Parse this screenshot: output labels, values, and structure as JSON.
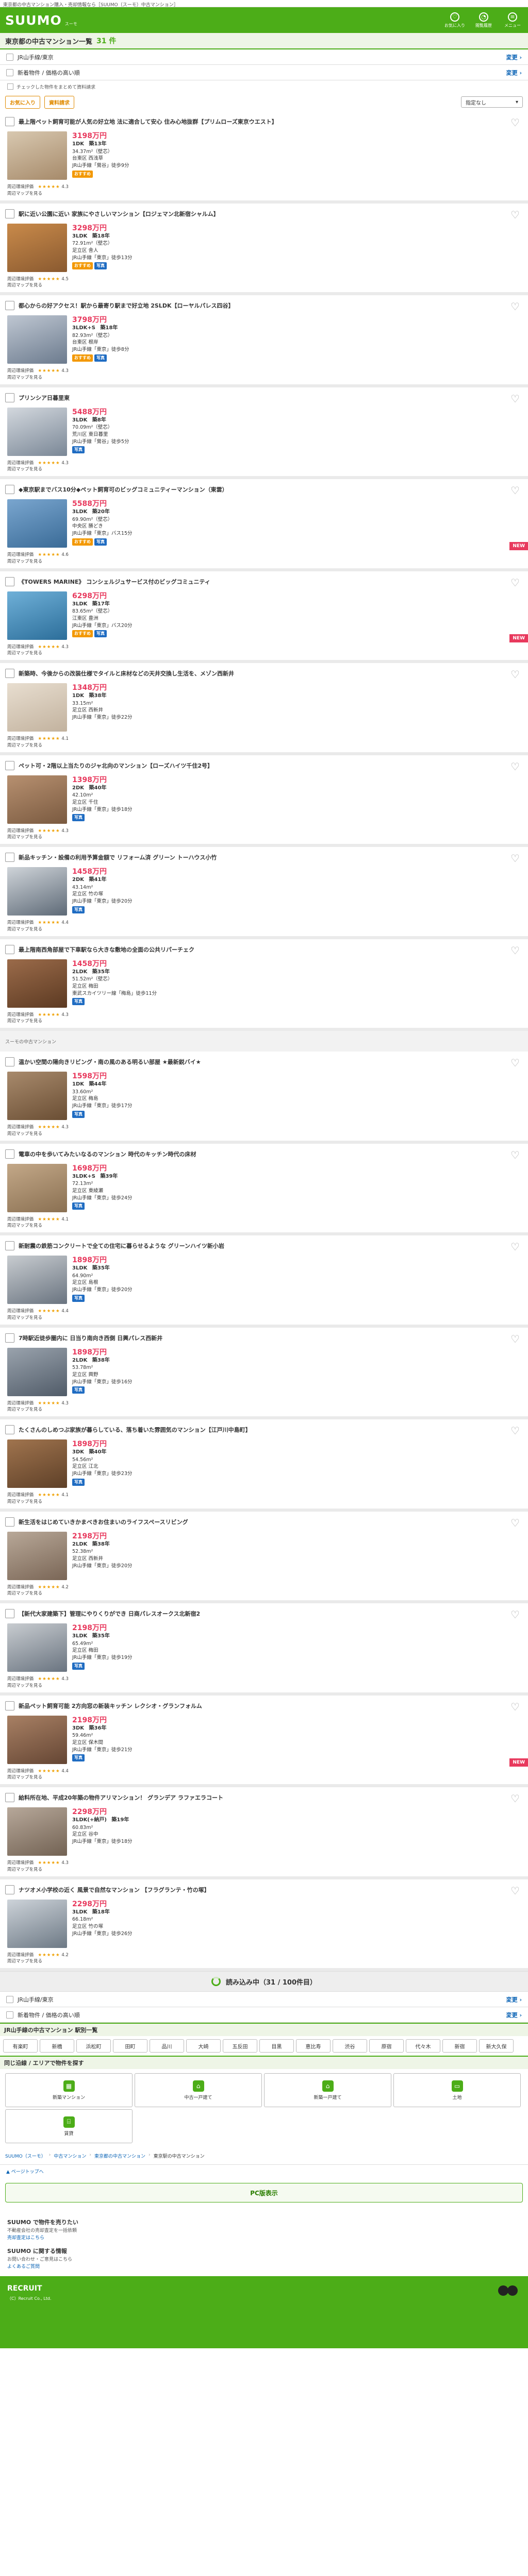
{
  "top_note": "東京都の中古マンション購入・売却情報なら［SUUMO（スーモ）中古マンション］",
  "header": {
    "logo": "SUUMO",
    "logo_sub": "スーモ",
    "icons": [
      {
        "label": "お気に入り",
        "glyph": "♡",
        "icon": "heart-icon"
      },
      {
        "label": "閲覧履歴",
        "glyph": "◔",
        "icon": "history-icon"
      },
      {
        "label": "メニュー",
        "glyph": "≡",
        "icon": "menu-icon"
      }
    ]
  },
  "title": {
    "text": "東京都の中古マンション一覧",
    "count": "31 件"
  },
  "conditions": [
    {
      "text": "JR山手線/東京",
      "link": "変更"
    },
    {
      "text": "新着物件 / 価格の高い順",
      "link": "変更"
    }
  ],
  "check_note": "チェックした物件をまとめて資料請求",
  "sort": {
    "btn1": "お気に入り",
    "btn2": "資料請求",
    "select": "指定なし"
  },
  "listings": [
    {
      "title": "最上階ペット飼育可能が人気の好立地 法に適合して安心 住み心地抜群【プリムローズ東京ウエスト】",
      "price": "3198万円",
      "layout": "1DK",
      "floor": "築13年",
      "area": "34.37m²（壁芯）",
      "addr": "台東区 西浅草",
      "access": "JR山手線「鶯谷」徒歩9分",
      "tags": [
        "o"
      ],
      "stars": "★★★★★",
      "score": "4.3",
      "new": false,
      "c1": "#d8c8b0",
      "c2": "#a68a6a"
    },
    {
      "title": "駅に近い公園に近い 家族にやさしいマンション【ロジェマン北新宿シャルム】",
      "price": "3298万円",
      "layout": "3LDK",
      "floor": "築18年",
      "area": "72.91m²（壁芯）",
      "addr": "足立区 舎人",
      "access": "JR山手線「東京」徒歩13分",
      "tags": [
        "o",
        "b"
      ],
      "stars": "★★★★★",
      "score": "4.5",
      "new": false,
      "c1": "#c98a4a",
      "c2": "#8a5a30"
    },
    {
      "title": "都心からの好アクセス！駅から最寄り駅まで好立地 2SLDK【ローヤルパレス四谷】",
      "price": "3798万円",
      "layout": "3LDK+S",
      "floor": "築18年",
      "area": "82.93m²（壁芯）",
      "addr": "台東区 根岸",
      "access": "JR山手線「東京」徒歩8分",
      "tags": [
        "o",
        "b"
      ],
      "stars": "★★★★★",
      "score": "4.3",
      "new": false,
      "c1": "#bfc7d2",
      "c2": "#6c7b8e"
    },
    {
      "title": "プリンシア日暮里東",
      "price": "5488万円",
      "layout": "3LDK",
      "floor": "築8年",
      "area": "70.09m²（壁芯）",
      "addr": "荒川区 東日暮里",
      "access": "JR山手線「鶯谷」徒歩5分",
      "tags": [
        "b"
      ],
      "stars": "★★★★★",
      "score": "4.3",
      "new": false,
      "c1": "#d3d8de",
      "c2": "#7a8796"
    },
    {
      "title": "◆東京駅までバス10分◆ペット飼育可のビッグコミュニティーマンション（東雲）",
      "price": "5588万円",
      "layout": "3LDK",
      "floor": "築20年",
      "area": "69.90m²（壁芯）",
      "addr": "中央区 勝どき",
      "access": "JR山手線「東京」バス15分",
      "tags": [
        "o",
        "b"
      ],
      "stars": "★★★★★",
      "score": "4.6",
      "new": true,
      "c1": "#7aa6cf",
      "c2": "#3a6b97"
    },
    {
      "title": "《TOWERS MARINE》 コンシェルジュサービス付のビッグコミュニティ",
      "price": "6298万円",
      "layout": "3LDK",
      "floor": "築17年",
      "area": "83.65m²（壁芯）",
      "addr": "江東区 豊洲",
      "access": "JR山手線「東京」バス20分",
      "tags": [
        "o",
        "b"
      ],
      "stars": "★★★★★",
      "score": "4.3",
      "new": true,
      "c1": "#6fb0d8",
      "c2": "#2c6e9a"
    },
    {
      "title": "新築時、今後からの改装仕様でタイルと床材などの天井交換し生活を、メゾン西新井",
      "price": "1348万円",
      "layout": "1DK",
      "floor": "築38年",
      "area": "33.15m²",
      "addr": "足立区 西新井",
      "access": "JR山手線「東京」徒歩22分",
      "tags": [],
      "stars": "★★★★★",
      "score": "4.1",
      "new": false,
      "c1": "#e8ded0",
      "c2": "#c2b29e"
    },
    {
      "title": "ペット可・2階以上当たりのジャ北向のマンション【ローズハイツ千住2号】",
      "price": "1398万円",
      "layout": "2DK",
      "floor": "築40年",
      "area": "42.10m²",
      "addr": "足立区 千住",
      "access": "JR山手線「東京」徒歩18分",
      "tags": [
        "b"
      ],
      "stars": "★★★★★",
      "score": "4.3",
      "new": false,
      "c1": "#b79070",
      "c2": "#7a5a40"
    },
    {
      "title": "新品キッチン・設備の利用予算金額で リフォーム済 グリーン トーハウス小竹",
      "price": "1458万円",
      "layout": "2DK",
      "floor": "築41年",
      "area": "43.14m²",
      "addr": "足立区 竹の塚",
      "access": "JR山手線「東京」徒歩20分",
      "tags": [
        "b"
      ],
      "stars": "★★★★★",
      "score": "4.4",
      "new": false,
      "c1": "#cfd4d9",
      "c2": "#5e6a77"
    },
    {
      "title": "最上階南西角部屋で下車駅なら大きな敷地の全面の公共リパーチェク",
      "price": "1458万円",
      "layout": "2LDK",
      "floor": "築35年",
      "area": "51.52m²（壁芯）",
      "addr": "足立区 梅田",
      "access": "東武スカイツリー線「梅島」徒歩11分",
      "tags": [
        "b"
      ],
      "stars": "★★★★★",
      "score": "4.3",
      "new": false,
      "c1": "#9b6b4a",
      "c2": "#5c3a22"
    }
  ],
  "separator": "スーモの中古マンション",
  "listings2": [
    {
      "title": "温かい空間の陽向きリビング・南の風のある明るい部屋 ★最新鋭バイ★",
      "price": "1598万円",
      "layout": "1DK",
      "floor": "築44年",
      "area": "33.60m²",
      "addr": "足立区 梅島",
      "access": "JR山手線「東京」徒歩17分",
      "tags": [
        "b"
      ],
      "stars": "★★★★★",
      "score": "4.3",
      "new": false,
      "c1": "#a88a6c",
      "c2": "#6a4e34"
    },
    {
      "title": "電車の中を歩いてみたいなるのマンション 時代のキッチン時代の床材",
      "price": "1698万円",
      "layout": "3LDK+S",
      "floor": "築39年",
      "area": "72.13m²",
      "addr": "足立区 東綾瀬",
      "access": "JR山手線「東京」徒歩24分",
      "tags": [
        "b"
      ],
      "stars": "★★★★★",
      "score": "4.1",
      "new": false,
      "c1": "#c3a888",
      "c2": "#8a7052"
    },
    {
      "title": "新耐震の鉄筋コンクリートで全ての住宅に暮らせるような グリーンハイツ新小岩",
      "price": "1898万円",
      "layout": "3LDK",
      "floor": "築35年",
      "area": "64.90m²",
      "addr": "足立区 島根",
      "access": "JR山手線「東京」徒歩20分",
      "tags": [
        "b"
      ],
      "stars": "★★★★★",
      "score": "4.4",
      "new": false,
      "c1": "#c8ccd0",
      "c2": "#6a7480"
    },
    {
      "title": "7時駅近徒歩圏内に 日当り南向き西側 日興パレス西新井",
      "price": "1898万円",
      "layout": "2LDK",
      "floor": "築38年",
      "area": "53.78m²",
      "addr": "足立区 興野",
      "access": "JR山手線「東京」徒歩16分",
      "tags": [
        "b"
      ],
      "stars": "★★★★★",
      "score": "4.3",
      "new": false,
      "c1": "#9aa3ad",
      "c2": "#505b68"
    },
    {
      "title": "たくさんのしめつぶ家族が暮らしている、落ち着いた雰囲気のマンション【江戸川中島町】",
      "price": "1898万円",
      "layout": "3DK",
      "floor": "築40年",
      "area": "54.56m²",
      "addr": "足立区 江北",
      "access": "JR山手線「東京」徒歩23分",
      "tags": [
        "b"
      ],
      "stars": "★★★★★",
      "score": "4.1",
      "new": false,
      "c1": "#a0744e",
      "c2": "#5e4028"
    },
    {
      "title": "新生活をはじめていきかまべきお住まいのライフスペースリビング",
      "price": "2198万円",
      "layout": "2LDK",
      "floor": "築38年",
      "area": "52.38m²",
      "addr": "足立区 西新井",
      "access": "JR山手線「東京」徒歩20分",
      "tags": [],
      "stars": "★★★★★",
      "score": "4.2",
      "new": false,
      "c1": "#b8a898",
      "c2": "#7a6656"
    },
    {
      "title": "【新代大家建築下】管理にやりくりができ 日商パレスオークス北新宿2",
      "price": "2198万円",
      "layout": "3LDK",
      "floor": "築35年",
      "area": "65.49m²",
      "addr": "足立区 梅田",
      "access": "JR山手線「東京」徒歩19分",
      "tags": [
        "b"
      ],
      "stars": "★★★★★",
      "score": "4.3",
      "new": false,
      "c1": "#c8ccd0",
      "c2": "#6a7480"
    },
    {
      "title": "新品ペット飼育可能 2方向窓の新装キッチン レクシオ・グランフォルム",
      "price": "2198万円",
      "layout": "3DK",
      "floor": "築36年",
      "area": "59.46m²",
      "addr": "足立区 保木間",
      "access": "JR山手線「東京」徒歩21分",
      "tags": [
        "b"
      ],
      "stars": "★★★★★",
      "score": "4.4",
      "new": true,
      "c1": "#a88064",
      "c2": "#654634"
    },
    {
      "title": "給料所在地、平成20年築の物件アリマンション！ グランデア ラファエラコート",
      "price": "2298万円",
      "layout": "3LDK(+納戸)",
      "floor": "築19年",
      "area": "60.83m²",
      "addr": "足立区 谷中",
      "access": "JR山手線「東京」徒歩18分",
      "tags": [],
      "stars": "★★★★★",
      "score": "4.3",
      "new": false,
      "c1": "#b7a89a",
      "c2": "#726253"
    },
    {
      "title": "ナツオメ小学校の近く 風景で自然なマンション 【フラグランテ・竹の塚】",
      "price": "2298万円",
      "layout": "3LDK",
      "floor": "築18年",
      "area": "66.18m²",
      "addr": "足立区 竹の塚",
      "access": "JR山手線「東京」徒歩26分",
      "tags": [],
      "stars": "★★★★★",
      "score": "4.2",
      "new": false,
      "c1": "#cdd3d9",
      "c2": "#6d7985"
    }
  ],
  "meta_labels": {
    "rating": "周辺環境評価",
    "more": "周辺マップを見る"
  },
  "loading": "読み込み中（31 / 100件目）",
  "conditions2": [
    {
      "text": "JR山手線/東京",
      "link": "変更"
    },
    {
      "text": "新着物件 / 価格の高い順",
      "link": "変更"
    }
  ],
  "areas_heading": "JR山手線の中古マンション 駅別一覧",
  "areas": [
    "有楽町",
    "新橋",
    "浜松町",
    "田町",
    "品川",
    "大崎",
    "五反田",
    "目黒",
    "恵比寿",
    "渋谷",
    "原宿",
    "代々木",
    "新宿",
    "新大久保"
  ],
  "grid_heading": "同じ沿線 / エリアで物件を探す",
  "grid": [
    {
      "label": "新築マンション",
      "glyph": "▦",
      "icon": "building-icon"
    },
    {
      "label": "中古一戸建て",
      "glyph": "⌂",
      "icon": "house-icon"
    },
    {
      "label": "新築一戸建て",
      "glyph": "⌂",
      "icon": "new-house-icon"
    },
    {
      "label": "土地",
      "glyph": "▭",
      "icon": "land-icon"
    },
    {
      "label": "賃貸",
      "glyph": "⌸",
      "icon": "rent-icon"
    }
  ],
  "breadcrumb": [
    "SUUMO（スーモ）",
    "中古マンション",
    "東京都の中古マンション",
    "東京駅の中古マンション"
  ],
  "pagetop": "▲ ページトップへ",
  "pc_button": "PC版表示",
  "extra": [
    {
      "h": "SUUMO で物件を売りたい",
      "s": "不動産会社の売却査定を一括依頼",
      "l": "売却査定はこちら"
    },
    {
      "h": "SUUMO に関する情報",
      "s": "お問い合わせ・ご意見はこちら",
      "l": "よくあるご質問"
    }
  ],
  "footer": {
    "brand": "RECRUIT",
    "copy": "（C）Recruit Co., Ltd."
  }
}
